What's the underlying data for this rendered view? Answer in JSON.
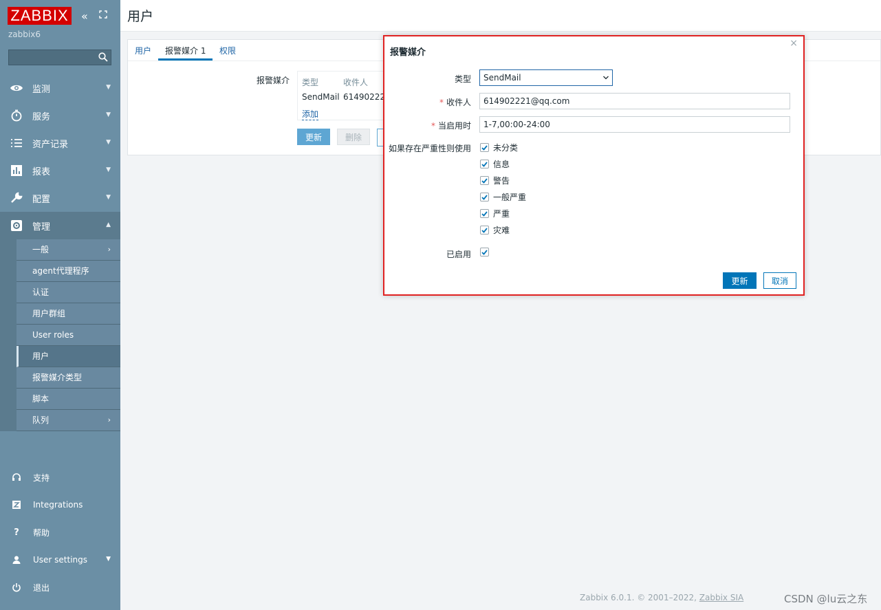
{
  "sidebar": {
    "logo": "ZABBIX",
    "server_name": "zabbix6",
    "search_placeholder": "",
    "menu": [
      {
        "label": "监测",
        "icon": "eye-icon"
      },
      {
        "label": "服务",
        "icon": "stopwatch-icon"
      },
      {
        "label": "资产记录",
        "icon": "list-icon"
      },
      {
        "label": "报表",
        "icon": "bar-chart-icon"
      },
      {
        "label": "配置",
        "icon": "wrench-icon"
      },
      {
        "label": "管理",
        "icon": "gear-icon"
      }
    ],
    "admin_submenu": [
      "一般",
      "agent代理程序",
      "认证",
      "用户群组",
      "User roles",
      "用户",
      "报警媒介类型",
      "脚本",
      "队列"
    ],
    "bottom": [
      {
        "label": "支持",
        "icon": "headset-icon"
      },
      {
        "label": "Integrations",
        "icon": "z-icon"
      },
      {
        "label": "帮助",
        "icon": "question-icon"
      },
      {
        "label": "User settings",
        "icon": "user-icon"
      },
      {
        "label": "退出",
        "icon": "power-icon"
      }
    ]
  },
  "page": {
    "title": "用户",
    "tabs": [
      "用户",
      "报警媒介 1",
      "权限"
    ],
    "media_label": "报警媒介",
    "table": {
      "headers": [
        "类型",
        "收件人"
      ],
      "row": [
        "SendMail",
        "61490222"
      ]
    },
    "add_link": "添加",
    "update_button": "更新",
    "delete_button": "删除"
  },
  "modal": {
    "title": "报警媒介",
    "close": "×",
    "type_label": "类型",
    "type_value": "SendMail",
    "recipient_label": "收件人",
    "recipient_value": "614902221@qq.com",
    "when_active_label": "当启用时",
    "when_active_value": "1-7,00:00-24:00",
    "severity_label": "如果存在严重性则使用",
    "severities": [
      "未分类",
      "信息",
      "警告",
      "一般严重",
      "严重",
      "灾难"
    ],
    "enabled_label": "已启用",
    "update_button": "更新",
    "cancel_button": "取消"
  },
  "footer": {
    "text": "Zabbix 6.0.1. © 2001–2022,",
    "company": "Zabbix SIA"
  },
  "watermark": "CSDN @lu云之东",
  "colors": {
    "sidebar": "#6b8fa5",
    "primary": "#0275b8",
    "logo": "#d40000",
    "highlight_border": "#e02121"
  }
}
